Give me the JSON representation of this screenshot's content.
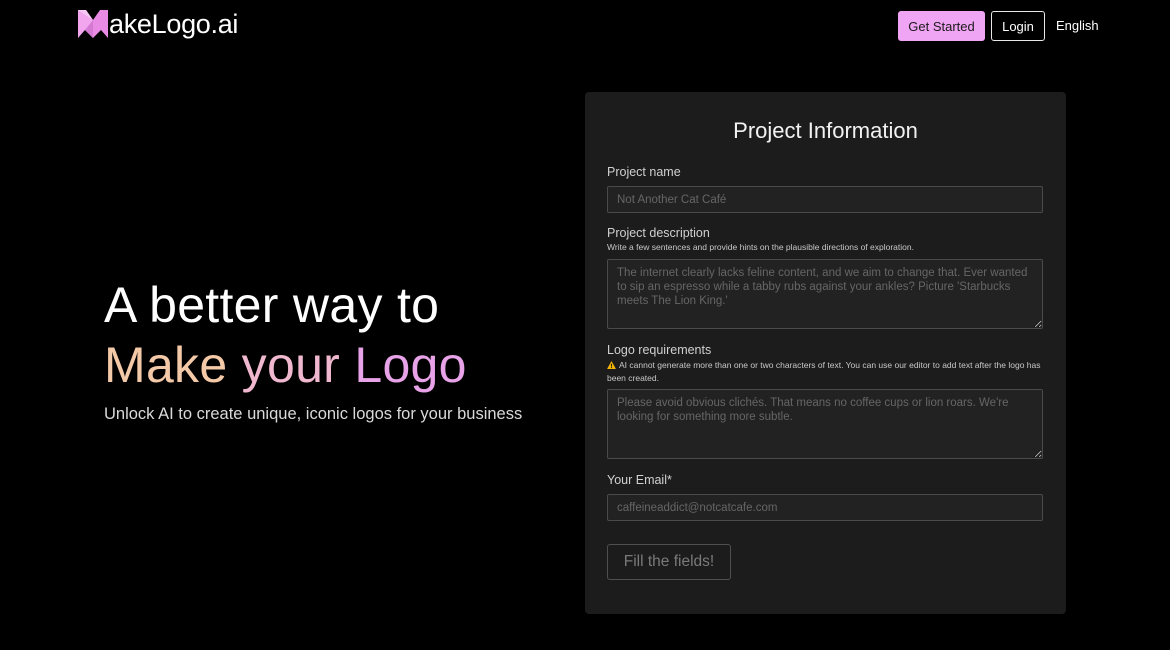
{
  "header": {
    "logo_text": "akeLogo.ai",
    "get_started_label": "Get Started",
    "login_label": "Login",
    "language_label": "English"
  },
  "hero": {
    "line1": "A better way to",
    "line2_word1": "Make",
    "line2_word2": "your",
    "line2_word3": "Logo",
    "subtitle": "Unlock AI to create unique, iconic logos for your business"
  },
  "form": {
    "title": "Project Information",
    "project_name": {
      "label": "Project name",
      "placeholder": "Not Another Cat Café"
    },
    "project_description": {
      "label": "Project description",
      "hint": "Write a few sentences and provide hints on the plausible directions of exploration.",
      "placeholder": "The internet clearly lacks feline content, and we aim to change that. Ever wanted to sip an espresso while a tabby rubs against your ankles? Picture 'Starbucks meets The Lion King.'"
    },
    "logo_requirements": {
      "label": "Logo requirements",
      "hint": "AI cannot generate more than one or two characters of text. You can use our editor to add text after the logo has been created.",
      "placeholder": "Please avoid obvious clichés. That means no coffee cups or lion roars. We're looking for something more subtle."
    },
    "email": {
      "label": "Your Email*",
      "placeholder": "caffeineaddict@notcatcafe.com"
    },
    "submit_label": "Fill the fields!"
  },
  "colors": {
    "accent": "#f0a4f4",
    "background": "#000000",
    "card": "#1c1c1c",
    "warning": "#f5b400"
  },
  "icons": {
    "logo": "makelogo-m-icon",
    "warning": "warning-triangle-icon"
  }
}
